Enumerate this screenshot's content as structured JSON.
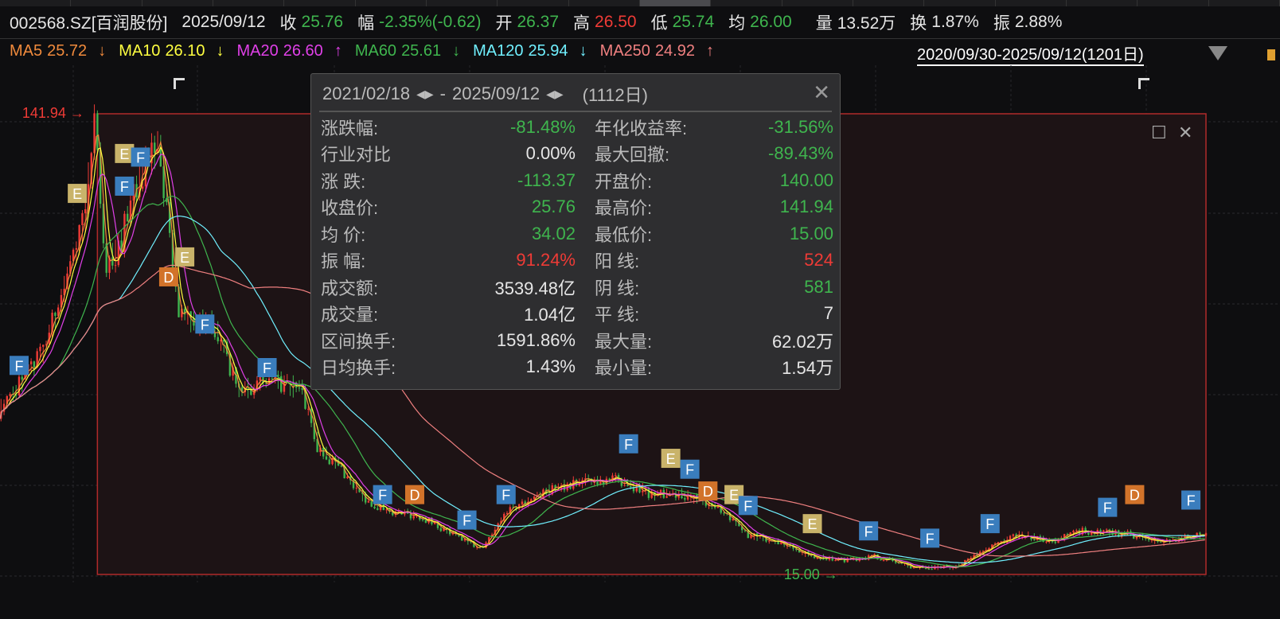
{
  "header": {
    "code": "002568.SZ[百润股份]",
    "date": "2025/09/12",
    "close_label": "收",
    "close": "25.76",
    "chg_label": "幅",
    "chg": "-2.35%(-0.62)",
    "open_label": "开",
    "open": "26.37",
    "high_label": "高",
    "high": "26.50",
    "low_label": "低",
    "low": "25.74",
    "avg_label": "均",
    "avg": "26.00",
    "vol_label": "量",
    "vol": "13.52万",
    "turn_label": "换",
    "turn": "1.87%",
    "amp_label": "振",
    "amp": "2.88%"
  },
  "ma": [
    {
      "label": "MA5",
      "value": "25.72",
      "arrow": "↓",
      "color": "#f08a3c"
    },
    {
      "label": "MA10",
      "value": "26.10",
      "arrow": "↓",
      "color": "#ffff40"
    },
    {
      "label": "MA20",
      "value": "26.60",
      "arrow": "↑",
      "color": "#e040e8"
    },
    {
      "label": "MA60",
      "value": "25.61",
      "arrow": "↓",
      "color": "#3fb54e"
    },
    {
      "label": "MA120",
      "value": "25.94",
      "arrow": "↓",
      "color": "#70f0ff"
    },
    {
      "label": "MA250",
      "value": "24.92",
      "arrow": "↑",
      "color": "#f08080"
    }
  ],
  "range": "2020/09/30-2025/09/12(1201日)",
  "popup": {
    "start": "2021/02/18",
    "end": "2025/09/12",
    "sep": "-",
    "days": "(1112日)",
    "arrows": "◀▶",
    "rows": [
      {
        "l": "涨跌幅:",
        "v": "-81.48%",
        "c": "green",
        "l2": "年化收益率:",
        "v2": "-31.56%",
        "c2": "green"
      },
      {
        "l": "行业对比",
        "v": "0.00%",
        "c": "white",
        "l2": "最大回撤:",
        "v2": "-89.43%",
        "c2": "green"
      },
      {
        "l": "涨  跌:",
        "v": "-113.37",
        "c": "green",
        "l2": "开盘价:",
        "v2": "140.00",
        "c2": "green"
      },
      {
        "l": "收盘价:",
        "v": "25.76",
        "c": "green",
        "l2": "最高价:",
        "v2": "141.94",
        "c2": "green"
      },
      {
        "l": "均  价:",
        "v": "34.02",
        "c": "green",
        "l2": "最低价:",
        "v2": "15.00",
        "c2": "green"
      },
      {
        "l": "振  幅:",
        "v": "91.24%",
        "c": "red",
        "l2": "阳  线:",
        "v2": "524",
        "c2": "red"
      },
      {
        "l": "成交额:",
        "v": "3539.48亿",
        "c": "white",
        "l2": "阴  线:",
        "v2": "581",
        "c2": "green"
      },
      {
        "l": "成交量:",
        "v": "1.04亿",
        "c": "white",
        "l2": "平  线:",
        "v2": "7",
        "c2": "white"
      },
      {
        "l": "区间换手:",
        "v": "1591.86%",
        "c": "white",
        "l2": "最大量:",
        "v2": "62.02万",
        "c2": "white"
      },
      {
        "l": "日均换手:",
        "v": "1.43%",
        "c": "white",
        "l2": "最小量:",
        "v2": "1.54万",
        "c2": "white"
      }
    ]
  },
  "chart_data": {
    "type": "candlestick",
    "total_days": 1201,
    "ylim": [
      15,
      141.94
    ],
    "max_label": "141.94",
    "min_label": "15.00",
    "max_day": 95,
    "min_day": 898,
    "sel_start_day": 97,
    "key_closes": [
      [
        0,
        60
      ],
      [
        40,
        75
      ],
      [
        63,
        92
      ],
      [
        83,
        112
      ],
      [
        95,
        138
      ],
      [
        107,
        100
      ],
      [
        119,
        104
      ],
      [
        135,
        122
      ],
      [
        159,
        134
      ],
      [
        170,
        106
      ],
      [
        178,
        88
      ],
      [
        198,
        84
      ],
      [
        214,
        84
      ],
      [
        238,
        66
      ],
      [
        270,
        68
      ],
      [
        301,
        66
      ],
      [
        317,
        50
      ],
      [
        341,
        44
      ],
      [
        365,
        35
      ],
      [
        396,
        32
      ],
      [
        420,
        31
      ],
      [
        452,
        26
      ],
      [
        480,
        22
      ],
      [
        507,
        33
      ],
      [
        555,
        39
      ],
      [
        587,
        41
      ],
      [
        618,
        41
      ],
      [
        650,
        37
      ],
      [
        682,
        37
      ],
      [
        713,
        34
      ],
      [
        745,
        26
      ],
      [
        777,
        24
      ],
      [
        809,
        20
      ],
      [
        840,
        19
      ],
      [
        872,
        20
      ],
      [
        912,
        17
      ],
      [
        951,
        17
      ],
      [
        983,
        22
      ],
      [
        1015,
        26
      ],
      [
        1046,
        24
      ],
      [
        1078,
        27
      ],
      [
        1126,
        26
      ],
      [
        1157,
        24
      ],
      [
        1197,
        25.8
      ]
    ],
    "markers": [
      {
        "t": "F",
        "day": 19,
        "p": 72.6
      },
      {
        "t": "E",
        "day": 77,
        "p": 120
      },
      {
        "t": "E",
        "day": 124,
        "p": 131
      },
      {
        "t": "F",
        "day": 140,
        "p": 130
      },
      {
        "t": "F",
        "day": 124,
        "p": 122
      },
      {
        "t": "D",
        "day": 168,
        "p": 97
      },
      {
        "t": "E",
        "day": 184,
        "p": 102.5
      },
      {
        "t": "F",
        "day": 204,
        "p": 84
      },
      {
        "t": "F",
        "day": 266,
        "p": 72
      },
      {
        "t": "F",
        "day": 381,
        "p": 37
      },
      {
        "t": "D",
        "day": 413,
        "p": 37
      },
      {
        "t": "F",
        "day": 465,
        "p": 30
      },
      {
        "t": "F",
        "day": 504,
        "p": 37
      },
      {
        "t": "F",
        "day": 626,
        "p": 51
      },
      {
        "t": "E",
        "day": 668,
        "p": 47
      },
      {
        "t": "F",
        "day": 687,
        "p": 44
      },
      {
        "t": "D",
        "day": 705,
        "p": 38
      },
      {
        "t": "E",
        "day": 731,
        "p": 37
      },
      {
        "t": "F",
        "day": 745,
        "p": 34
      },
      {
        "t": "E",
        "day": 809,
        "p": 29
      },
      {
        "t": "F",
        "day": 865,
        "p": 27
      },
      {
        "t": "F",
        "day": 926,
        "p": 25
      },
      {
        "t": "F",
        "day": 986,
        "p": 29
      },
      {
        "t": "F",
        "day": 1103,
        "p": 33.5
      },
      {
        "t": "D",
        "day": 1130,
        "p": 37
      },
      {
        "t": "F",
        "day": 1186,
        "p": 35.5
      }
    ],
    "marker_colors": {
      "F": "#3a7dbd",
      "E": "#c9b36a",
      "D": "#d2732a"
    },
    "up_color": "#ef3b36",
    "down_color": "#3fb54e"
  }
}
